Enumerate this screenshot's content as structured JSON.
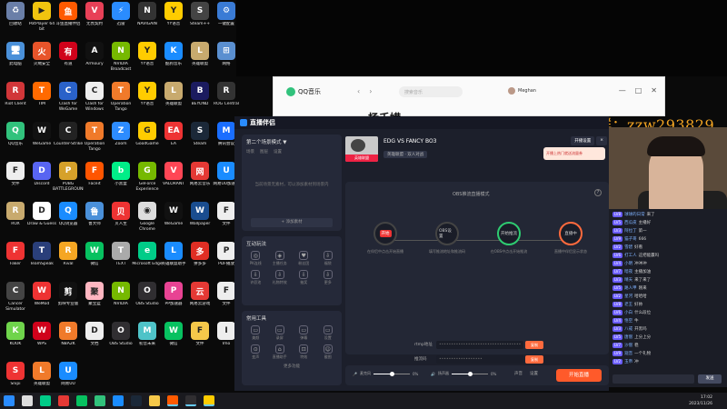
{
  "desktop_icons": [
    {
      "label": "回收站",
      "color": "#6a7fa8",
      "glyph": "♻"
    },
    {
      "label": "PotPlayer 64 bit",
      "color": "#f1c40f",
      "glyph": "▶"
    },
    {
      "label": "斗鱼直播伴侣",
      "color": "#ff5a00",
      "glyph": "鱼"
    },
    {
      "label": "无畏契约",
      "color": "#e84057",
      "glyph": "V"
    },
    {
      "label": "迅雷",
      "color": "#2a8cff",
      "glyph": "⚡"
    },
    {
      "label": "NAVIGAIN",
      "color": "#333",
      "glyph": "N"
    },
    {
      "label": "YY语音",
      "color": "#ffcc00",
      "glyph": "Y"
    },
    {
      "label": "Steam++",
      "color": "#444",
      "glyph": "S"
    },
    {
      "label": "一键配置",
      "color": "#3a7bd5",
      "glyph": "⚙"
    },
    {
      "label": "此电脑",
      "color": "#4a90d9",
      "glyph": "🖥"
    },
    {
      "label": "火绒安全",
      "color": "#e8542a",
      "glyph": "火"
    },
    {
      "label": "有道",
      "color": "#d0021b",
      "glyph": "有"
    },
    {
      "label": "Armoury",
      "color": "#111",
      "glyph": "A"
    },
    {
      "label": "NVIDIA Broadcast",
      "color": "#76b900",
      "glyph": "N"
    },
    {
      "label": "YY语音",
      "color": "#ffcc00",
      "glyph": "Y"
    },
    {
      "label": "酷狗音乐",
      "color": "#1a8cff",
      "glyph": "K"
    },
    {
      "label": "英雄联盟",
      "color": "#c8aa6e",
      "glyph": "L"
    },
    {
      "label": "网络",
      "color": "#5a8fd0",
      "glyph": "⊞"
    },
    {
      "label": "Riot Client",
      "color": "#d13639",
      "glyph": "R"
    },
    {
      "label": "TIM",
      "color": "#ff6a00",
      "glyph": "T"
    },
    {
      "label": "Clash for WeGame",
      "color": "#2a62c9",
      "glyph": "C"
    },
    {
      "label": "Clash for Windows",
      "color": "#eee",
      "glyph": "C"
    },
    {
      "label": "Operation Tango",
      "color": "#f07a2a",
      "glyph": "T"
    },
    {
      "label": "YY语音",
      "color": "#ffcc00",
      "glyph": "Y"
    },
    {
      "label": "英雄联盟",
      "color": "#c8aa6e",
      "glyph": "L"
    },
    {
      "label": "BEYOND",
      "color": "#1b1b5f",
      "glyph": "B"
    },
    {
      "label": "ROG Central",
      "color": "#333",
      "glyph": "R"
    },
    {
      "label": "QQ音乐",
      "color": "#31c27c",
      "glyph": "Q"
    },
    {
      "label": "WeGame",
      "color": "#111",
      "glyph": "W"
    },
    {
      "label": "Counter-Strike",
      "color": "#222",
      "glyph": "C"
    },
    {
      "label": "Operation Tango",
      "color": "#f07a2a",
      "glyph": "T"
    },
    {
      "label": "Zoom",
      "color": "#2d8cff",
      "glyph": "Z"
    },
    {
      "label": "GoodGame",
      "color": "#ffcc00",
      "glyph": "G"
    },
    {
      "label": "EA",
      "color": "#e33",
      "glyph": "EA"
    },
    {
      "label": "Steam",
      "color": "#1b2838",
      "glyph": "S"
    },
    {
      "label": "腾讯会议",
      "color": "#1a6eff",
      "glyph": "M"
    },
    {
      "label": "文件",
      "color": "#eee",
      "glyph": "F"
    },
    {
      "label": "Discord",
      "color": "#5865f2",
      "glyph": "D"
    },
    {
      "label": "PUBG BATTLEGROUNDS",
      "color": "#d6a12a",
      "glyph": "P"
    },
    {
      "label": "Faceit",
      "color": "#ff5500",
      "glyph": "F"
    },
    {
      "label": "小黑盒",
      "color": "#0e8",
      "glyph": "b"
    },
    {
      "label": "GeForce Experience",
      "color": "#76b900",
      "glyph": "G"
    },
    {
      "label": "VALORANT",
      "color": "#ff4655",
      "glyph": "V"
    },
    {
      "label": "网易云音乐",
      "color": "#e53935",
      "glyph": "网"
    },
    {
      "label": "网易UU加速器",
      "color": "#1a8cff",
      "glyph": "U"
    },
    {
      "label": "ROX",
      "color": "#c8aa6e",
      "glyph": "R"
    },
    {
      "label": "Draw & Guess",
      "color": "#fff",
      "glyph": "D"
    },
    {
      "label": "QQ浏览器",
      "color": "#1a8cff",
      "glyph": "Q"
    },
    {
      "label": "鲁大师",
      "color": "#4a90d9",
      "glyph": "鲁"
    },
    {
      "label": "贝人生",
      "color": "#e33",
      "glyph": "贝"
    },
    {
      "label": "Google Chrome",
      "color": "#ddd",
      "glyph": "◉"
    },
    {
      "label": "WeGame",
      "color": "#111",
      "glyph": "W"
    },
    {
      "label": "Wallpaper",
      "color": "#1a4d8f",
      "glyph": "W"
    },
    {
      "label": "文件",
      "color": "#eee",
      "glyph": "F"
    },
    {
      "label": "Faker",
      "color": "#e33",
      "glyph": "F"
    },
    {
      "label": "TeamSpeak",
      "color": "#2a3f7a",
      "glyph": "T"
    },
    {
      "label": "Rival",
      "color": "#f5a623",
      "glyph": "R"
    },
    {
      "label": "微信",
      "color": "#07c160",
      "glyph": "W"
    },
    {
      "label": "TEXT",
      "color": "#aaa",
      "glyph": "T"
    },
    {
      "label": "Microsoft Edge",
      "color": "#0c8",
      "glyph": "e"
    },
    {
      "label": "英雄联盟助手",
      "color": "#1a8cff",
      "glyph": "L"
    },
    {
      "label": "拼多多",
      "color": "#e02e24",
      "glyph": "多"
    },
    {
      "label": "PDF播放",
      "color": "#eee",
      "glyph": "P"
    },
    {
      "label": "Cancer Simulator",
      "color": "#444",
      "glyph": "C"
    },
    {
      "label": "WeMod",
      "color": "#e33",
      "glyph": "W"
    },
    {
      "label": "剪映专业版",
      "color": "#111",
      "glyph": "剪"
    },
    {
      "label": "聚宝盆",
      "color": "#ffb6c1",
      "glyph": "聚"
    },
    {
      "label": "NVIDIA",
      "color": "#76b900",
      "glyph": "N"
    },
    {
      "label": "OBS Studio",
      "color": "#302e31",
      "glyph": "O"
    },
    {
      "label": "PP加速器",
      "color": "#e84393",
      "glyph": "P"
    },
    {
      "label": "网易云游戏",
      "color": "#e53935",
      "glyph": "云"
    },
    {
      "label": "文件",
      "color": "#eee",
      "glyph": "F"
    },
    {
      "label": "KOOK",
      "color": "#6fd44b",
      "glyph": "K"
    },
    {
      "label": "WPS",
      "color": "#d0021b",
      "glyph": "W"
    },
    {
      "label": "NBA2K",
      "color": "#f07a2a",
      "glyph": "B"
    },
    {
      "label": "文档",
      "color": "#eee",
      "glyph": "D"
    },
    {
      "label": "OBS Studio",
      "color": "#302e31",
      "glyph": "O"
    },
    {
      "label": "初音未来",
      "color": "#4fc3c8",
      "glyph": "M"
    },
    {
      "label": "微信",
      "color": "#07c160",
      "glyph": "W"
    },
    {
      "label": "文件",
      "color": "#f5c84a",
      "glyph": "F"
    },
    {
      "label": "Imo",
      "color": "#eee",
      "glyph": "I"
    },
    {
      "label": "Snipi",
      "color": "#e33",
      "glyph": "S"
    },
    {
      "label": "英雄联盟",
      "color": "#f07a2a",
      "glyph": "L"
    },
    {
      "label": "网易UU",
      "color": "#1a8cff",
      "glyph": "U"
    }
  ],
  "qq_music": {
    "app_name": "QQ音乐",
    "search_placeholder": "搜索音乐",
    "user": "Meghan",
    "banner": "杨千嬅",
    "back": "‹",
    "forward": "›",
    "minimize": "—",
    "maximize": "□",
    "close": "✕"
  },
  "watermark": "微信群：zzw293829",
  "streaming_app": {
    "title": "直播伴侣",
    "scene_header": "第二个场景模式 ▼",
    "scene_tabs": [
      "场景",
      "图层",
      "设置"
    ],
    "empty_hint": "当前场景无素材，可以添加素材到场景内",
    "add_source": "+ 添加素材",
    "interact_header": "互动玩法",
    "interact_tools": [
      {
        "label": "PK连线",
        "glyph": "◎"
      },
      {
        "label": "主播任务",
        "glyph": "◈"
      },
      {
        "label": "粉丝团",
        "glyph": "♥"
      },
      {
        "label": "福袋",
        "glyph": "⇩"
      },
      {
        "label": "许愿池",
        "glyph": "⇩"
      },
      {
        "label": "礼物特效",
        "glyph": "⇩"
      },
      {
        "label": "抽奖",
        "glyph": "⇩"
      },
      {
        "label": "更多",
        "glyph": "⇩"
      }
    ],
    "tools_header": "常用工具",
    "common_tools": [
      {
        "label": "美颜",
        "glyph": "▭"
      },
      {
        "label": "录屏",
        "glyph": "▭"
      },
      {
        "label": "弹幕",
        "glyph": "▭"
      },
      {
        "label": "设置",
        "glyph": "▭"
      },
      {
        "label": "变声",
        "glyph": "⊙"
      },
      {
        "label": "直播助手",
        "glyph": "⌂"
      },
      {
        "label": "特效",
        "glyph": "⊡"
      },
      {
        "label": "截图",
        "glyph": "☺"
      }
    ],
    "more_tools": "更多功能",
    "room_title": "EDG VS FANCY BO3",
    "room_category": "英雄联盟 · 双人对战",
    "cover_caption": "英雄联盟",
    "header_buttons": [
      "开播设置",
      "×"
    ],
    "promo_text": "开播上热门就送流量券",
    "flow_title": "OBS推流直播模式",
    "help": "?",
    "steps": [
      {
        "tag": "开始",
        "desc": "在伴侣中点击开始直播"
      },
      {
        "tag": "OBS设置",
        "desc": "填写推流地址和推流码"
      },
      {
        "tag": "开始推流",
        "desc": "在OBS中点击开始推流"
      },
      {
        "tag": "直播中",
        "desc": "直播中伴侣显示状态"
      }
    ],
    "rtmp_rows": [
      {
        "label": "rtmp地址",
        "value": "••••••••••••••••••••••••••••••••••",
        "btn": "复制"
      },
      {
        "label": "推流码",
        "value": "••••••••••••••••••",
        "btn": "复制"
      }
    ],
    "rtmp_hint": "请将rtmp地址和推流码复制到OBS中，开启推流后直播",
    "mic_label": "麦克风",
    "speaker_label": "扬声器",
    "mic_value": "0%",
    "speaker_value": "0%",
    "right_controls": [
      "声音",
      "设置"
    ],
    "start_button": "开始直播",
    "status": "延迟: 0ms  |  码率: 0kbps  |  帧率: 0  |  CPU: 5%"
  },
  "chat": {
    "messages": [
      {
        "badge": "LV8",
        "name": "球球的日常",
        "text": "来了"
      },
      {
        "badge": "LV5",
        "name": "西瓜皮",
        "text": "主播好"
      },
      {
        "badge": "LV3",
        "name": "阿拉丁",
        "text": "第一"
      },
      {
        "badge": "LV9",
        "name": "猫子哥",
        "text": "666"
      },
      {
        "badge": "LV2",
        "name": "雪碧",
        "text": "好看"
      },
      {
        "badge": "LV6",
        "name": "打工人",
        "text": "这把能赢吗"
      },
      {
        "badge": "LV4",
        "name": "小明",
        "text": "冲冲冲"
      },
      {
        "badge": "LV7",
        "name": "暗夜",
        "text": "主播加油"
      },
      {
        "badge": "LV3",
        "name": "晴天",
        "text": "来了来了"
      },
      {
        "badge": "LV5",
        "name": "路人甲",
        "text": "刚来"
      },
      {
        "badge": "LV2",
        "name": "星河",
        "text": "哈哈哈"
      },
      {
        "badge": "LV8",
        "name": "老王",
        "text": "好帅"
      },
      {
        "badge": "LV6",
        "name": "小白",
        "text": "什么段位"
      },
      {
        "badge": "LV4",
        "name": "悟空",
        "text": "牛"
      },
      {
        "badge": "LV3",
        "name": "八戒",
        "text": "开黑吗"
      },
      {
        "badge": "LV5",
        "name": "唐僧",
        "text": "上分上分"
      },
      {
        "badge": "LV7",
        "name": "沙僧",
        "text": "稳"
      },
      {
        "badge": "LV9",
        "name": "观音",
        "text": "一个礼物"
      },
      {
        "badge": "LV2",
        "name": "玉帝",
        "text": "冲"
      }
    ],
    "send_label": "发送"
  },
  "taskbar": {
    "icons": [
      {
        "name": "start",
        "color": "#2a8cff"
      },
      {
        "name": "chrome",
        "color": "#ddd"
      },
      {
        "name": "edge",
        "color": "#0c8"
      },
      {
        "name": "netease",
        "color": "#e53935"
      },
      {
        "name": "wechat",
        "color": "#07c160"
      },
      {
        "name": "qq-music",
        "color": "#31c27c"
      },
      {
        "name": "vscode",
        "color": "#1a8cff"
      },
      {
        "name": "steam",
        "color": "#1b2838"
      },
      {
        "name": "folder",
        "color": "#f5c84a"
      },
      {
        "name": "douyu",
        "color": "#ff5a00"
      },
      {
        "name": "obs",
        "color": "#302e31"
      },
      {
        "name": "yy",
        "color": "#ffcc00"
      }
    ],
    "time": "17:02",
    "date": "2023/11/26"
  }
}
